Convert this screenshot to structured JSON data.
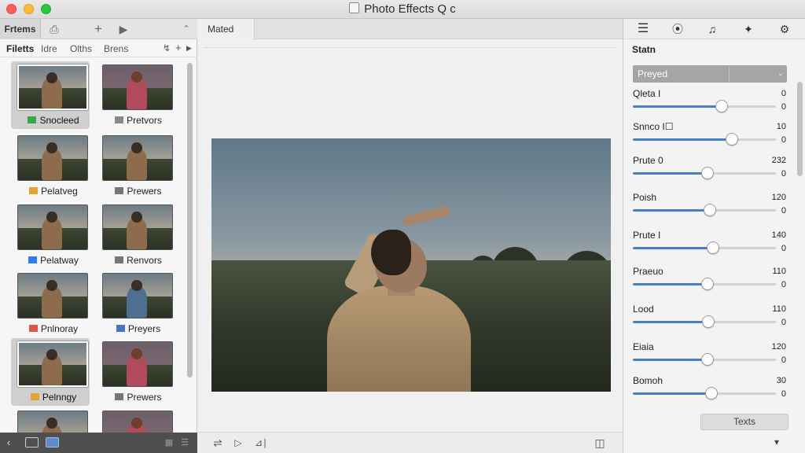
{
  "window": {
    "title": "Photo Effects Q c"
  },
  "left_panel": {
    "active_tab": "Frtems",
    "filters": [
      "Filetts",
      "Idre",
      "Olths",
      "Brens"
    ],
    "thumbnails": [
      {
        "label": "Snocleed",
        "icon_color": "#3aa84a",
        "variant": "dark",
        "selected": true
      },
      {
        "label": "Pretvors",
        "icon_color": "#888888",
        "variant": "pink",
        "selected": false
      },
      {
        "label": "Pelatveg",
        "icon_color": "#e3a431",
        "variant": "dark",
        "selected": false
      },
      {
        "label": "Prewers",
        "icon_color": "#777777",
        "variant": "dark",
        "selected": false
      },
      {
        "label": "Pelatway",
        "icon_color": "#2e7ee6",
        "variant": "dark",
        "selected": false
      },
      {
        "label": "Renvors",
        "icon_color": "#777777",
        "variant": "dark",
        "selected": false
      },
      {
        "label": "Pnlnoray",
        "icon_color": "#e0554a",
        "variant": "dark",
        "selected": false
      },
      {
        "label": "Preyers",
        "icon_color": "#4a73c1",
        "variant": "blue",
        "selected": false
      },
      {
        "label": "Pelnngy",
        "icon_color": "#e3a431",
        "variant": "dark",
        "selected": true
      },
      {
        "label": "Prewers",
        "icon_color": "#777777",
        "variant": "pink",
        "selected": false
      },
      {
        "label": "",
        "icon_color": "#777777",
        "variant": "dark",
        "selected": false
      },
      {
        "label": "",
        "icon_color": "#777777",
        "variant": "pink",
        "selected": false
      }
    ]
  },
  "center_panel": {
    "tab_label": "Mated"
  },
  "right_panel": {
    "section_title": "Statn",
    "preset_value": "Preyed",
    "sliders": [
      {
        "label": "Qleta I",
        "value": "0",
        "sub_value": "0",
        "level": 0.62
      },
      {
        "label": "Snnco I☐",
        "value": "10",
        "sub_value": "0",
        "level": 0.69
      },
      {
        "label": "Prute 0",
        "value": "232",
        "sub_value": "0",
        "level": 0.52
      },
      {
        "label": "Poish",
        "value": "120",
        "sub_value": "0",
        "level": 0.54
      },
      {
        "label": "Prute I",
        "value": "140",
        "sub_value": "0",
        "level": 0.56
      },
      {
        "label": "Praeuo",
        "value": "110",
        "sub_value": "0",
        "level": 0.52
      },
      {
        "label": "Lood",
        "value": "110",
        "sub_value": "0",
        "level": 0.53
      },
      {
        "label": "Eiaia",
        "value": "120",
        "sub_value": "0",
        "level": 0.52
      },
      {
        "label": "Bomoh",
        "value": "30",
        "sub_value": "0",
        "level": 0.55
      }
    ],
    "reset_button": "Texts"
  }
}
